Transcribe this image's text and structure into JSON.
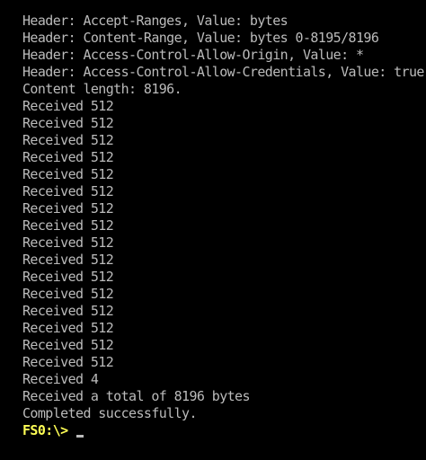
{
  "console": {
    "lines": [
      "Header: Accept-Ranges, Value: bytes",
      "Header: Content-Range, Value: bytes 0-8195/8196",
      "Header: Access-Control-Allow-Origin, Value: *",
      "Header: Access-Control-Allow-Credentials, Value: true",
      "Content length: 8196.",
      "Received 512",
      "Received 512",
      "Received 512",
      "Received 512",
      "Received 512",
      "Received 512",
      "Received 512",
      "Received 512",
      "Received 512",
      "Received 512",
      "Received 512",
      "Received 512",
      "Received 512",
      "Received 512",
      "Received 512",
      "Received 512",
      "Received 4",
      "Received a total of 8196 bytes",
      "Completed successfully."
    ],
    "prompt": "FS0:\\>",
    "text_color": "#bbbbbb",
    "prompt_color": "#ffff55",
    "background": "#000000"
  }
}
